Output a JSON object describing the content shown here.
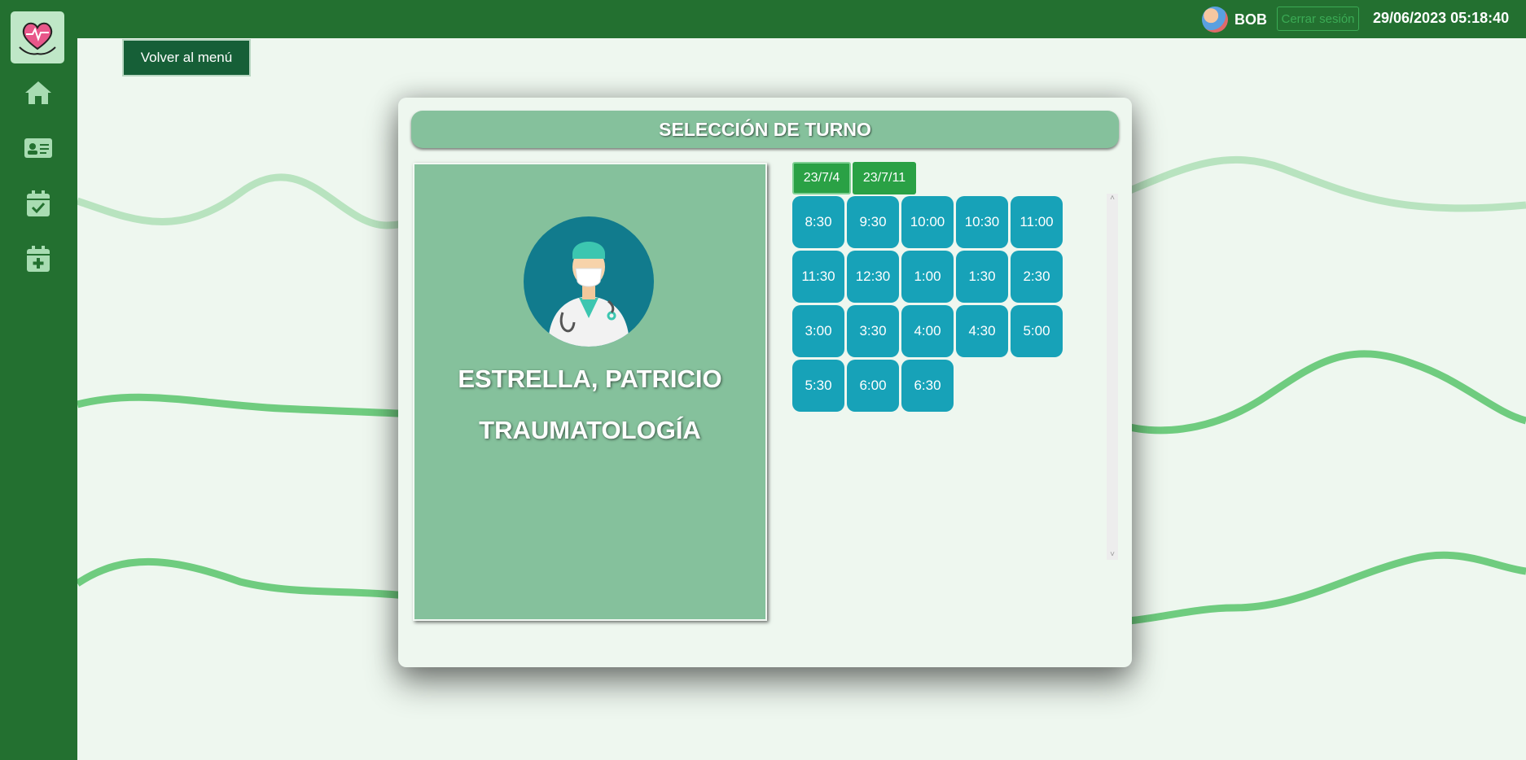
{
  "header": {
    "username": "BOB",
    "logout_label": "Cerrar sesión",
    "datetime": "29/06/2023 05:18:40"
  },
  "sidebar": {
    "items": [
      {
        "icon": "home-icon"
      },
      {
        "icon": "id-card-icon"
      },
      {
        "icon": "calendar-check-icon"
      },
      {
        "icon": "calendar-plus-icon"
      }
    ]
  },
  "back_label": "Volver al menú",
  "modal": {
    "title": "SELECCIÓN DE TURNO",
    "doctor_name": "ESTRELLA, PATRICIO",
    "specialty": "TRAUMATOLOGÍA",
    "dates": [
      "23/7/4",
      "23/7/11"
    ],
    "slots": [
      "8:30",
      "9:30",
      "10:00",
      "10:30",
      "11:00",
      "11:30",
      "12:30",
      "1:00",
      "1:30",
      "2:30",
      "3:00",
      "3:30",
      "4:00",
      "4:30",
      "5:00",
      "5:30",
      "6:00",
      "6:30"
    ]
  },
  "colors": {
    "sidebar": "#237030",
    "accent_green": "#2aa145",
    "slot_teal": "#17a2b8",
    "card_green": "#85c19c"
  }
}
